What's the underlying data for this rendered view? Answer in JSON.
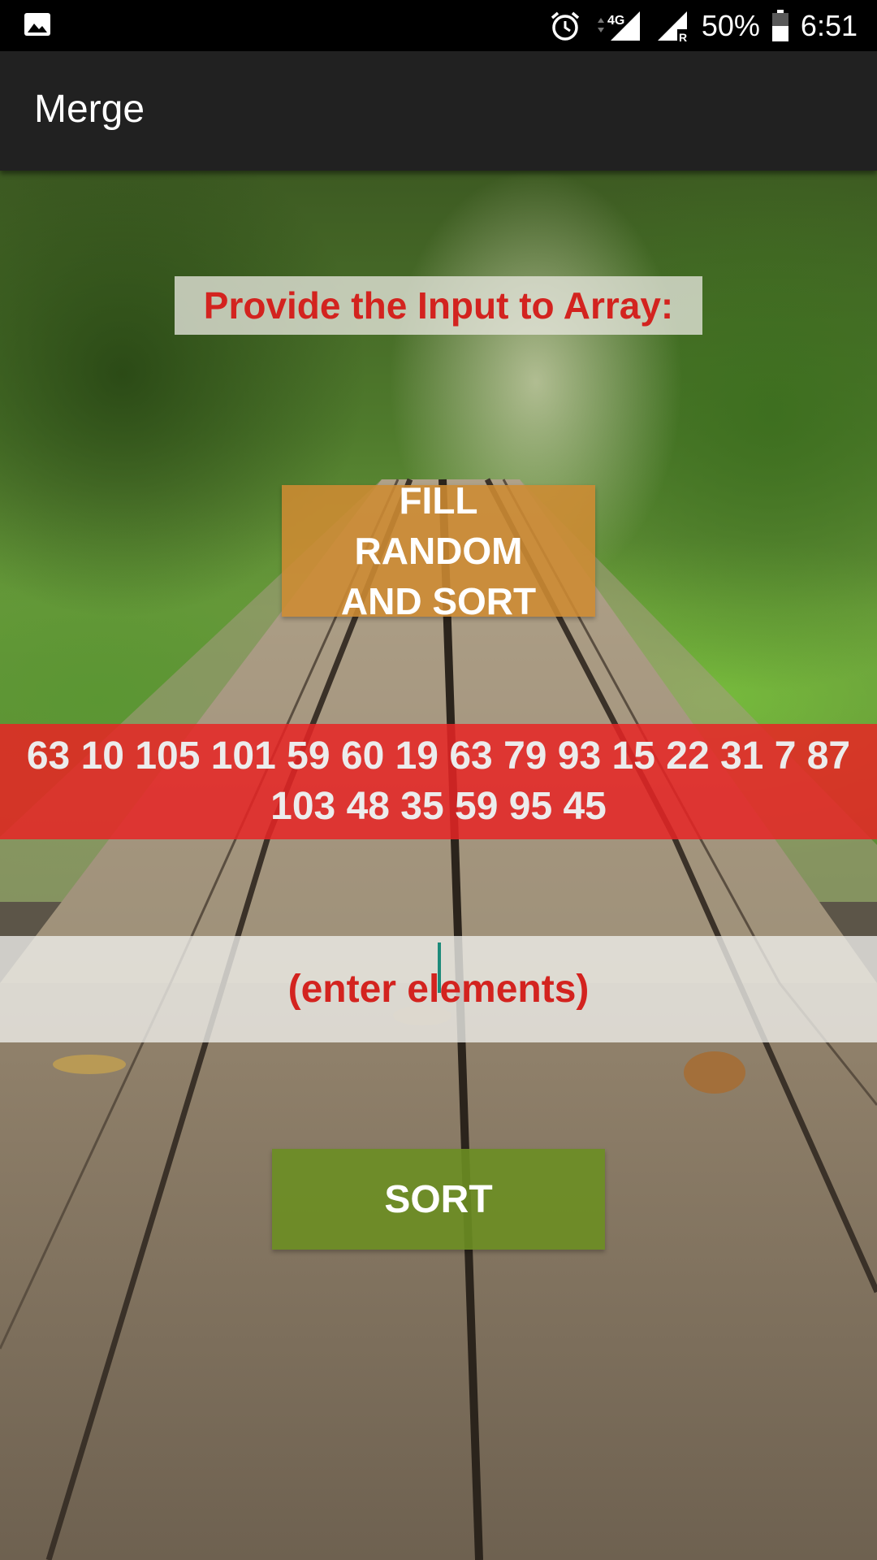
{
  "status_bar": {
    "battery": "50%",
    "time": "6:51",
    "network": "4G",
    "icons": [
      "gallery-icon",
      "alarm-icon",
      "signal-4g-icon",
      "signal-roaming-icon",
      "battery-icon"
    ]
  },
  "app_bar": {
    "title": "Merge"
  },
  "main": {
    "prompt": "Provide the Input to Array:",
    "fill_button_label": "FILL RANDOM AND SORT",
    "result_text": "63 10 105 101 59 60 19 63 79 93 15 22 31 7 87 103 48 35 59 95 45",
    "input_placeholder": "(enter elements)",
    "input_value": "",
    "sort_button_label": "SORT"
  },
  "colors": {
    "status_bar": "#000000",
    "app_bar": "#212121",
    "prompt_text": "#d3231f",
    "fill_button": "#ce8b32",
    "result_band": "#e82424",
    "sort_button": "#6c8e22",
    "cursor": "#1d8a7a"
  }
}
